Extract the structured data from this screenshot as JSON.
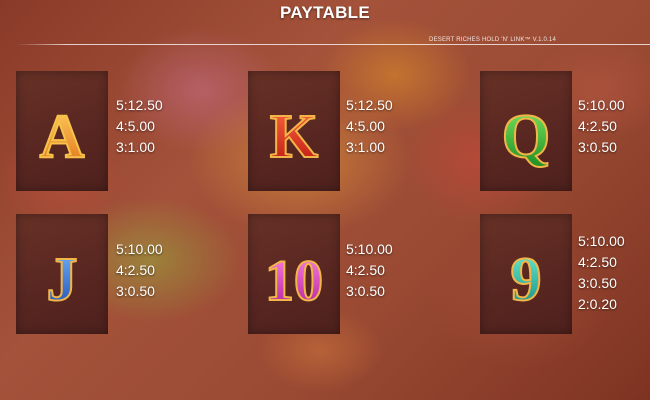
{
  "title": "PAYTABLE",
  "version": "DESERT RICHES HOLD 'N' LINK™ V.1.0.14",
  "symbols": [
    {
      "name": "A",
      "color": "#e48a1e",
      "pays": [
        "5:12.50",
        "4:5.00",
        "3:1.00"
      ]
    },
    {
      "name": "K",
      "color": "#d42a1c",
      "pays": [
        "5:12.50",
        "4:5.00",
        "3:1.00"
      ]
    },
    {
      "name": "Q",
      "color": "#2ea834",
      "pays": [
        "5:10.00",
        "4:2.50",
        "3:0.50"
      ]
    },
    {
      "name": "J",
      "color": "#2f6fd0",
      "pays": [
        "5:10.00",
        "4:2.50",
        "3:0.50"
      ]
    },
    {
      "name": "10",
      "color": "#d83ab8",
      "pays": [
        "5:10.00",
        "4:2.50",
        "3:0.50"
      ]
    },
    {
      "name": "9",
      "color": "#1ea594",
      "pays": [
        "5:10.00",
        "4:2.50",
        "3:0.50",
        "2:0.20"
      ]
    }
  ]
}
